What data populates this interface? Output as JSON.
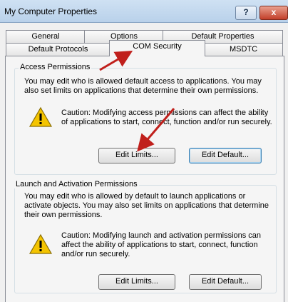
{
  "window": {
    "title": "My Computer Properties",
    "help_label": "?",
    "close_label": "x"
  },
  "tabs": {
    "general": "General",
    "options": "Options",
    "default_properties": "Default Properties",
    "default_protocols": "Default Protocols",
    "com_security": "COM Security",
    "msdtc": "MSDTC"
  },
  "access": {
    "legend": "Access Permissions",
    "description": "You may edit who is allowed default access to applications. You may also set limits on applications that determine their own permissions.",
    "caution": "Caution: Modifying access permissions can affect the ability of applications to start, connect, function and/or run securely.",
    "edit_limits": "Edit Limits...",
    "edit_default": "Edit Default..."
  },
  "launch": {
    "legend": "Launch and Activation Permissions",
    "description": "You may edit who is allowed by default to launch applications or activate objects. You may also set limits on applications that determine their own permissions.",
    "caution": "Caution: Modifying launch and activation permissions can affect the ability of applications to start, connect, function and/or run securely.",
    "edit_limits": "Edit Limits...",
    "edit_default": "Edit Default..."
  },
  "colors": {
    "arrow": "#c0201c",
    "warning_fill": "#f4c400"
  }
}
